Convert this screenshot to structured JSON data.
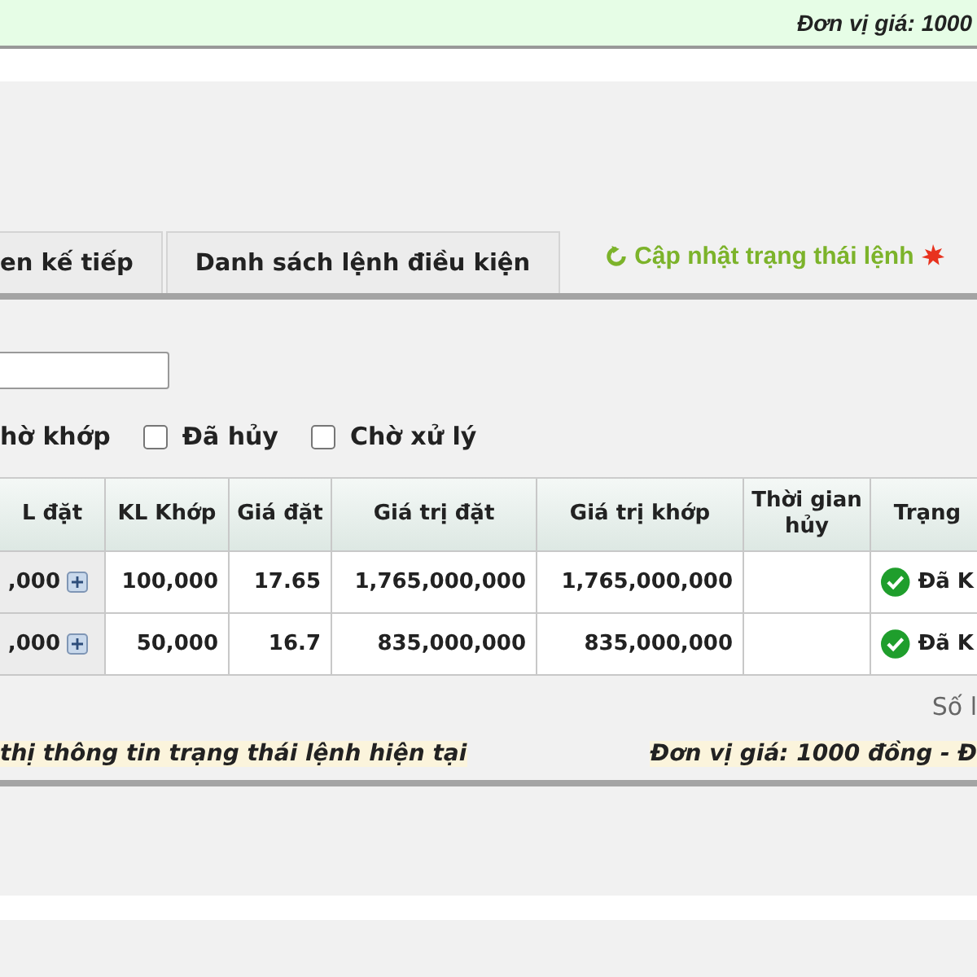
{
  "top_bar": {
    "price_unit": "Đơn vị giá: 1000"
  },
  "tabs": [
    {
      "label": "en kế tiếp",
      "selected": false
    },
    {
      "label": "Danh sách lệnh điều kiện",
      "selected": false
    }
  ],
  "refresh_link": "Cập nhật trạng thái lệnh",
  "filters": [
    {
      "label": "hờ khớp"
    },
    {
      "label": "Đã hủy",
      "checked": false
    },
    {
      "label": "Chờ xử lý",
      "checked": false
    }
  ],
  "table": {
    "columns": [
      "L đặt",
      "KL Khớp",
      "Giá đặt",
      "Giá trị đặt",
      "Giá trị khớp",
      "Thời gian hủy",
      "Trạng"
    ],
    "rows": [
      {
        "cells": [
          ",000",
          "100,000",
          "17.65",
          "1,765,000,000",
          "1,765,000,000",
          ""
        ],
        "status": "Đã K",
        "expandable": true
      },
      {
        "cells": [
          ",000",
          "50,000",
          "16.7",
          "835,000,000",
          "835,000,000",
          ""
        ],
        "status": "Đã K",
        "expandable": true
      }
    ]
  },
  "pagination": "Số l",
  "footer": {
    "note": "thị thông tin trạng thái lệnh hiện tại",
    "price_unit": "Đơn vị giá: 1000 đồng - Đ"
  }
}
